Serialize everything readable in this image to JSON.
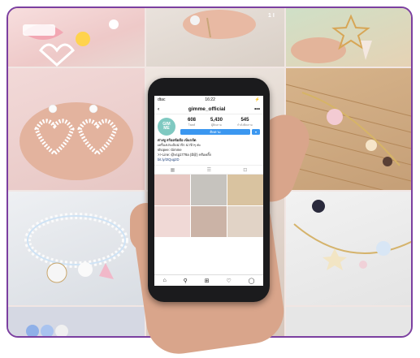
{
  "status_bar": {
    "carrier": "dtac",
    "time": "16:22",
    "battery": "⚡"
  },
  "profile": {
    "username": "gimme_official",
    "avatar_text": "GIM\nME",
    "posts": "608",
    "posts_label": "โพสต์",
    "followers": "5,430",
    "followers_label": "ผู้ติดตาม",
    "following": "545",
    "following_label": "กำลังติดตาม",
    "follow_button": "ติดตาม",
    "more_button": "▾"
  },
  "bio": {
    "line1": "ต่างหู สร้อยข้อมือ เข็มกลัด",
    "line2": "เครื่องประดับน่ารัก น่ารักๆ ค่ะ",
    "line3": "shopee: Gimme",
    "line4": ">> Line: @vcg1778a (มี@) หรือคลิ๊ก",
    "link": "bit.ly/2tQug2D"
  },
  "nav_icons": [
    "home-icon",
    "search-icon",
    "add-icon",
    "heart-icon",
    "profile-icon"
  ],
  "tile_caption": "1 I"
}
